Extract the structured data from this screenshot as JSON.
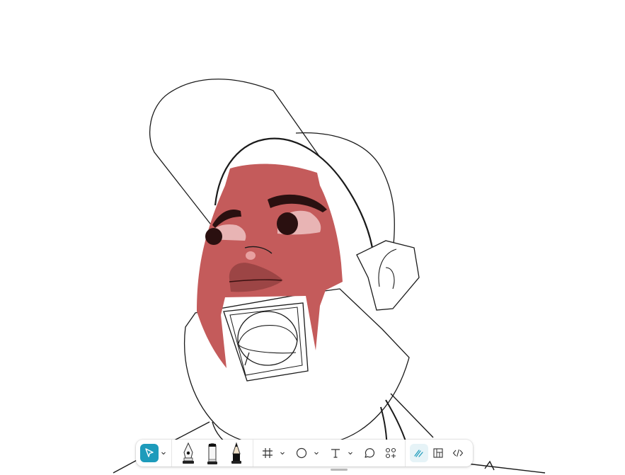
{
  "app": {
    "name": "vector-design-canvas"
  },
  "colors": {
    "skin": "#c45b5b",
    "skin_dark": "#9c4545",
    "eye_white": "#e8b4b4",
    "line": "#1a1a1a",
    "accent": "#1d9bbb",
    "active_bg": "#e6f3f7",
    "icon": "#333333"
  },
  "toolbar": {
    "groups": [
      {
        "name": "select",
        "tools": [
          "move-tool",
          "move-options"
        ]
      },
      {
        "name": "drawing",
        "tools": [
          "pen-tool",
          "marker-tool",
          "pencil-tool"
        ]
      },
      {
        "name": "creation",
        "tools": [
          "frame-tool",
          "ellipse-tool",
          "text-tool",
          "comment-tool",
          "actions-tool"
        ]
      },
      {
        "name": "modes",
        "tools": [
          "draw-mode",
          "design-mode",
          "dev-mode"
        ]
      }
    ],
    "active_tool": "move-tool",
    "active_mode": "draw-mode"
  }
}
